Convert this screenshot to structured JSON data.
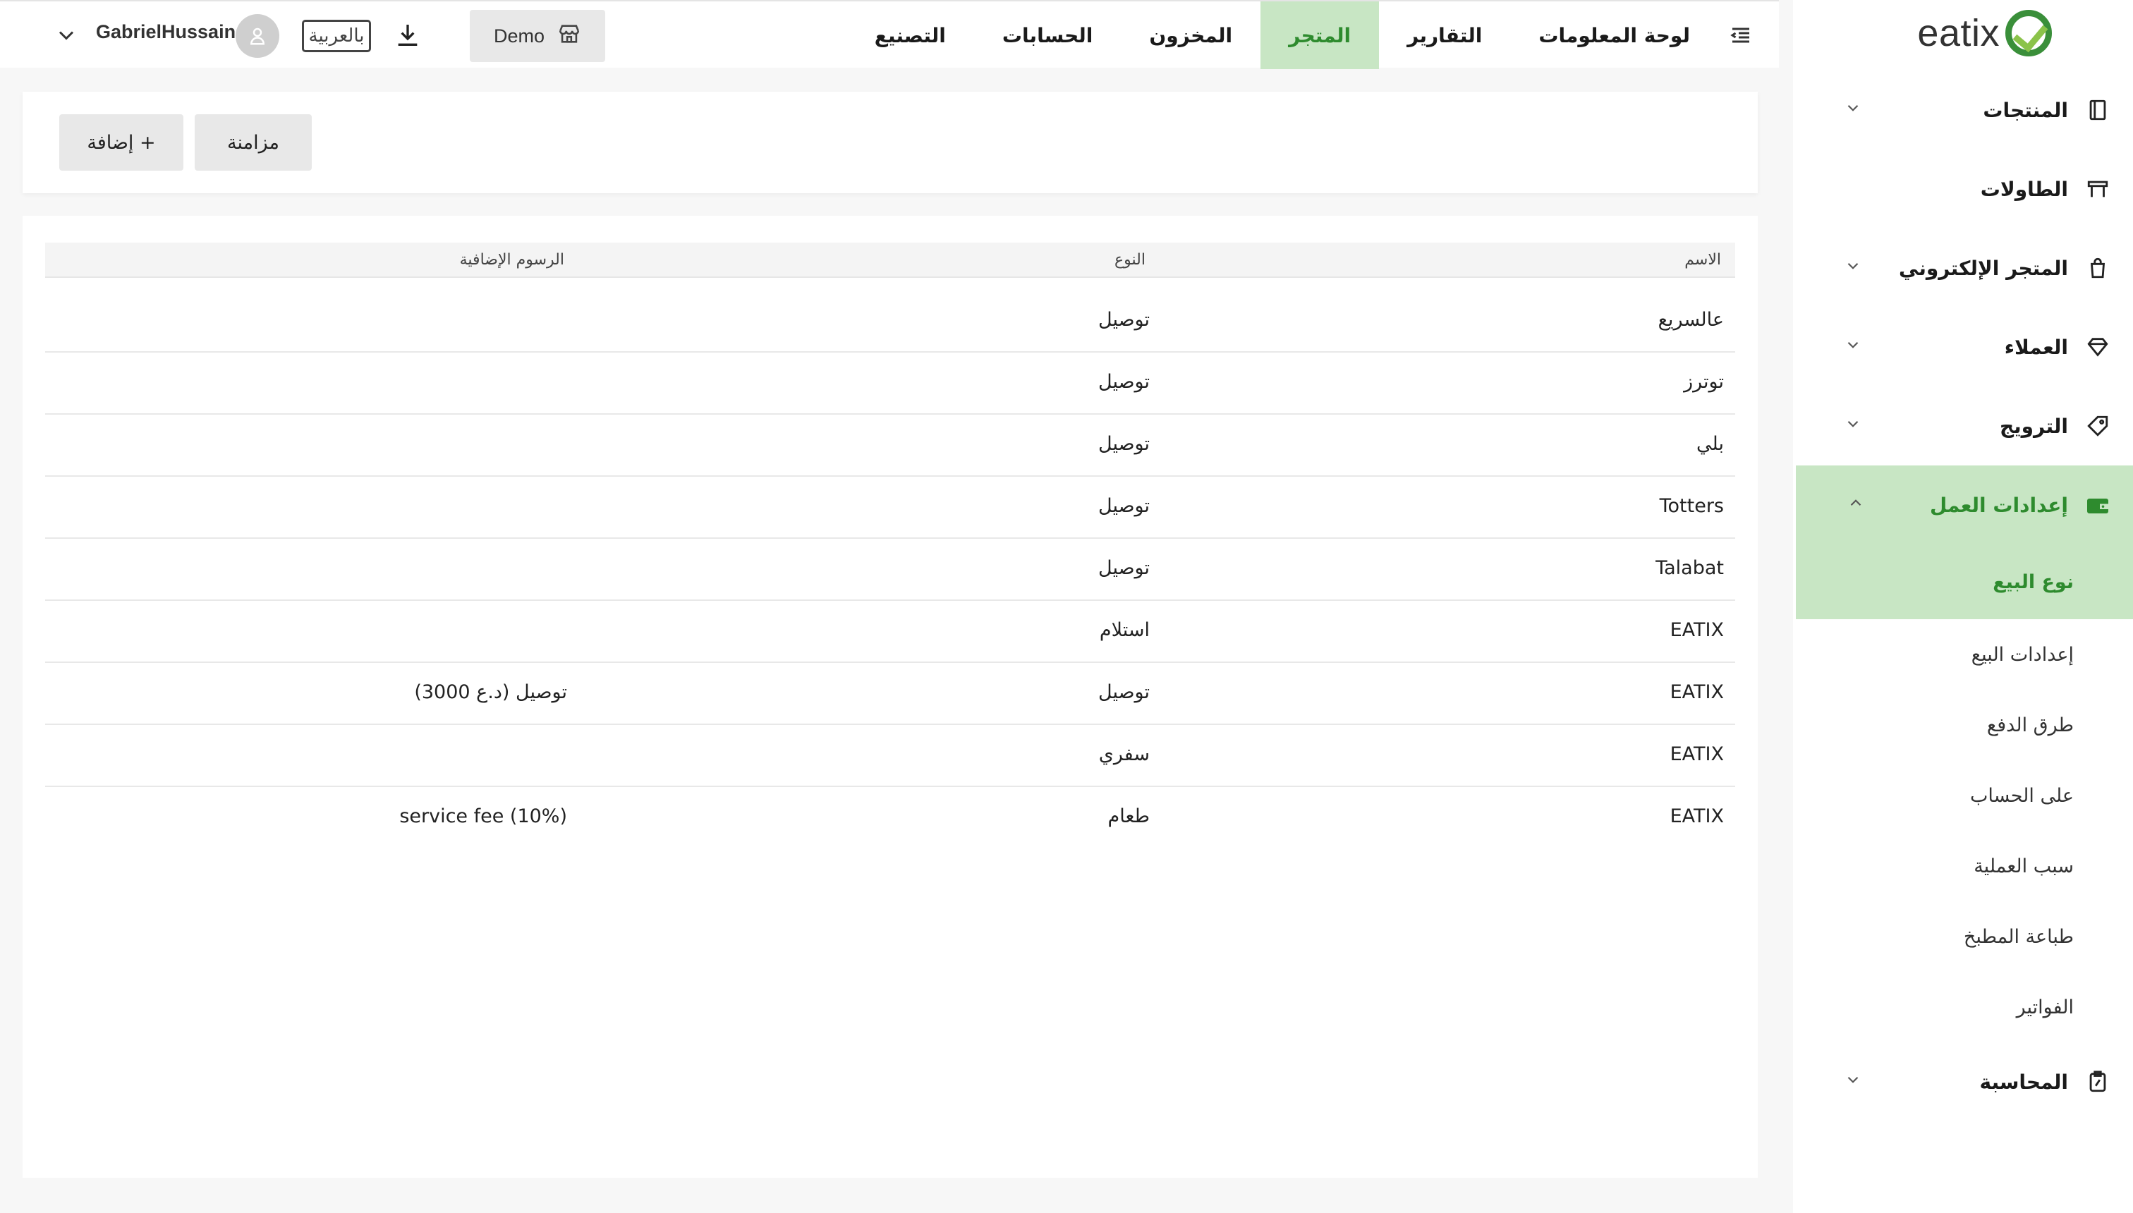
{
  "app": {
    "logo_text": "eatix"
  },
  "topbar": {
    "tabs": [
      {
        "label": "لوحة المعلومات"
      },
      {
        "label": "التقارير"
      },
      {
        "label": "المتجر"
      },
      {
        "label": "المخزون"
      },
      {
        "label": "الحسابات"
      },
      {
        "label": "التصنيع"
      }
    ],
    "active_tab": "المتجر",
    "store_label": "Demo",
    "language_label": "بالعربية",
    "username": "GabrielHussain"
  },
  "sidebar": {
    "items": [
      {
        "label": "المنتجات",
        "icon": "book-icon",
        "has_chevron": true
      },
      {
        "label": "الطاولات",
        "icon": "table-icon",
        "has_chevron": false
      },
      {
        "label": "المتجر الإلكتروني",
        "icon": "shopping-bag-icon",
        "has_chevron": true
      },
      {
        "label": "العملاء",
        "icon": "diamond-icon",
        "has_chevron": true
      },
      {
        "label": "الترويج",
        "icon": "tag-icon",
        "has_chevron": true
      },
      {
        "label": "إعدادات العمل",
        "icon": "wallet-icon",
        "has_chevron": true,
        "expanded": true
      },
      {
        "label": "المحاسبة",
        "icon": "clipboard-icon",
        "has_chevron": true
      }
    ],
    "subitems": [
      {
        "label": "نوع البيع",
        "active": true
      },
      {
        "label": "إعدادات البيع"
      },
      {
        "label": "طرق الدفع"
      },
      {
        "label": "على الحساب"
      },
      {
        "label": "سبب العملية"
      },
      {
        "label": "طباعة المطبخ"
      },
      {
        "label": "الفواتير"
      }
    ]
  },
  "actions": {
    "sync_label": "مزامنة",
    "add_label": "+ إضافة"
  },
  "table": {
    "headers": {
      "name": "الاسم",
      "type": "النوع",
      "fee": "الرسوم الإضافية"
    },
    "rows": [
      {
        "name": "عالسريع",
        "type": "توصيل",
        "fee": ""
      },
      {
        "name": "توترز",
        "type": "توصيل",
        "fee": ""
      },
      {
        "name": "بلي",
        "type": "توصيل",
        "fee": ""
      },
      {
        "name": "Totters",
        "type": "توصيل",
        "fee": ""
      },
      {
        "name": "Talabat",
        "type": "توصيل",
        "fee": ""
      },
      {
        "name": "EATIX",
        "type": "استلام",
        "fee": ""
      },
      {
        "name": "EATIX",
        "type": "توصيل",
        "fee": "توصيل (د.ع 3000)"
      },
      {
        "name": "EATIX",
        "type": "سفري",
        "fee": ""
      },
      {
        "name": "EATIX",
        "type": "طعام",
        "fee": "service fee (10%)"
      }
    ]
  },
  "colors": {
    "accent": "#2e8b2e",
    "accent_bg": "#c8e6c4",
    "logo_light": "#8bc34a"
  }
}
